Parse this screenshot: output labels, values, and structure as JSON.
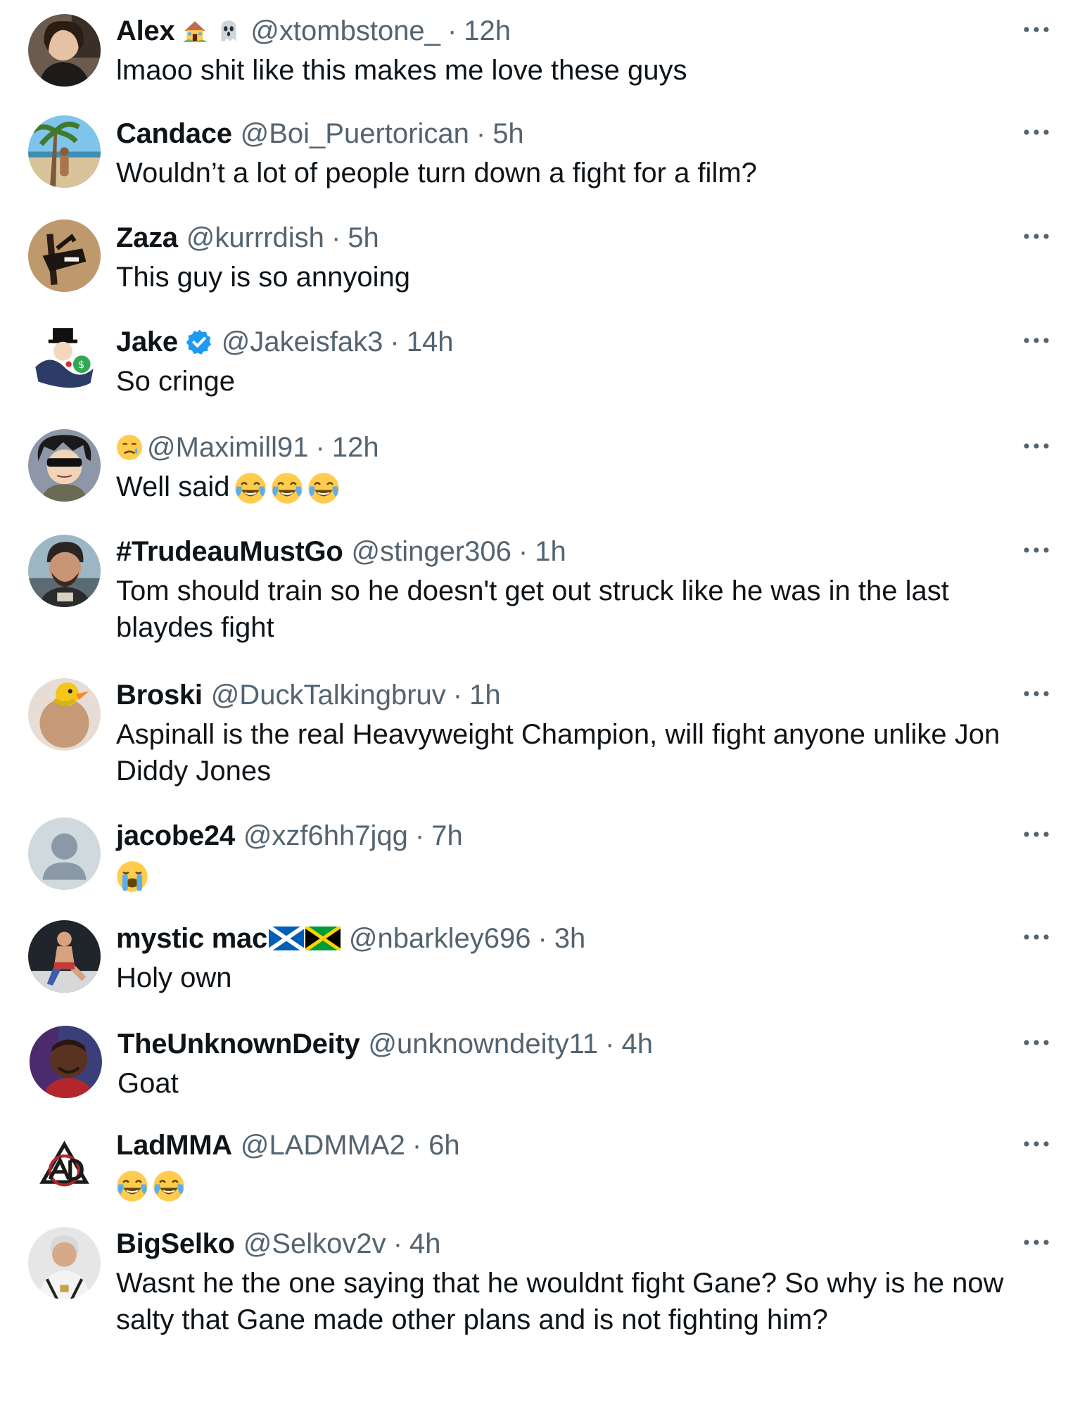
{
  "replies": [
    {
      "name": "Alex",
      "handle": "@xtombstone_",
      "dot": "·",
      "time": "12h",
      "text": "lmaoo shit like this makes me love these guys",
      "name_emojis": [
        "house-emoji",
        "ghost-emoji"
      ]
    },
    {
      "name": "Candace",
      "handle": "@Boi_Puertorican",
      "dot": "·",
      "time": "5h",
      "text": "Wouldn’t a lot of people turn down a fight for a film?"
    },
    {
      "name": "Zaza",
      "handle": "@kurrrdish",
      "dot": "·",
      "time": "5h",
      "text": "This guy is so annyoing"
    },
    {
      "name": "Jake",
      "handle": "@Jakeisfak3",
      "dot": "·",
      "time": "14h",
      "text": "So cringe",
      "verified": true,
      "verified_color": "#1d9bf0"
    },
    {
      "name": "",
      "handle": "@Maximill91",
      "dot": "·",
      "time": "12h",
      "text": "Well said",
      "name_emojis": [
        "sad-face-emoji"
      ],
      "text_emojis": [
        "tears-of-joy-emoji",
        "tears-of-joy-emoji",
        "tears-of-joy-emoji"
      ]
    },
    {
      "name": "#TrudeauMustGo",
      "handle": "@stinger306",
      "dot": "·",
      "time": "1h",
      "text": "Tom should train so he doesn't get out struck like he was in the last blaydes fight"
    },
    {
      "name": "Broski",
      "handle": "@DuckTalkingbruv",
      "dot": "·",
      "time": "1h",
      "text": "Aspinall is the real Heavyweight Champion, will fight anyone unlike Jon Diddy Jones"
    },
    {
      "name": "jacobe24",
      "handle": "@xzf6hh7jqg",
      "dot": "·",
      "time": "7h",
      "text": "",
      "text_emojis": [
        "loudly-crying-emoji"
      ]
    },
    {
      "name": "mystic mac",
      "handle": "@nbarkley696",
      "dot": "·",
      "time": "3h",
      "text": "Holy own",
      "flags": [
        "scotland-flag",
        "jamaica-flag"
      ]
    },
    {
      "name": "TheUnknownDeity",
      "handle": "@unknowndeity11",
      "dot": "·",
      "time": "4h",
      "text": "Goat"
    },
    {
      "name": "LadMMA",
      "handle": "@LADMMA2",
      "dot": "·",
      "time": "6h",
      "text": "",
      "text_emojis": [
        "tears-of-joy-emoji",
        "tears-of-joy-emoji"
      ]
    },
    {
      "name": "BigSelko",
      "handle": "@Selkov2v",
      "dot": "·",
      "time": "4h",
      "text": "Wasnt he the one saying that he wouldnt fight Gane? So why is he now salty that Gane made other plans and is not fighting him?"
    }
  ],
  "colors": {
    "text_primary": "#0f1419",
    "text_secondary": "#536471",
    "verified": "#1d9bf0",
    "background": "#ffffff"
  },
  "icons": {
    "more": "more-options-icon",
    "verified": "verified-badge-icon"
  }
}
